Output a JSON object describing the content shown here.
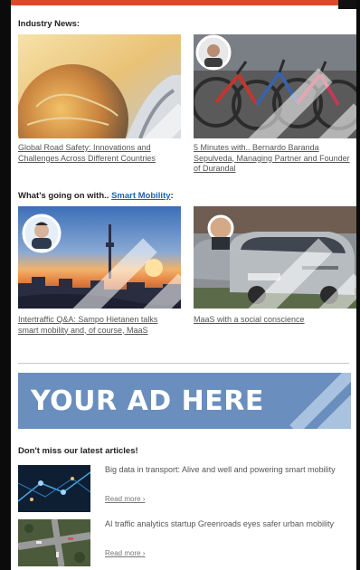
{
  "sections": {
    "industry_news": "Industry News:",
    "whats_going_on_prefix": "What's going on with..",
    "whats_going_on_link": "Smart Mobility",
    "whats_going_on_suffix": ":",
    "latest_articles": "Don't miss our latest articles!"
  },
  "cards": [
    {
      "title": "Global Road Safety: Innovations and Challenges Across Different Countries"
    },
    {
      "title": "5 Minutes with.. Bernardo Baranda Sepulveda, Managing Partner and Founder of Durandal"
    },
    {
      "title": "Intertraffic Q&A: Sampo Hietanen talks smart mobility and, of course, MaaS"
    },
    {
      "title": "MaaS with a social conscience"
    }
  ],
  "ad": {
    "text": "YOUR AD HERE"
  },
  "articles": [
    {
      "title": "Big data in transport: Alive and well and powering smart mobility",
      "read_more": "Read more ›"
    },
    {
      "title": "AI traffic analytics startup Greenroads eyes safer urban mobility",
      "read_more": "Read more ›"
    }
  ],
  "colors": {
    "link": "#1b63b5",
    "ad_background": "#6a8ebd"
  }
}
